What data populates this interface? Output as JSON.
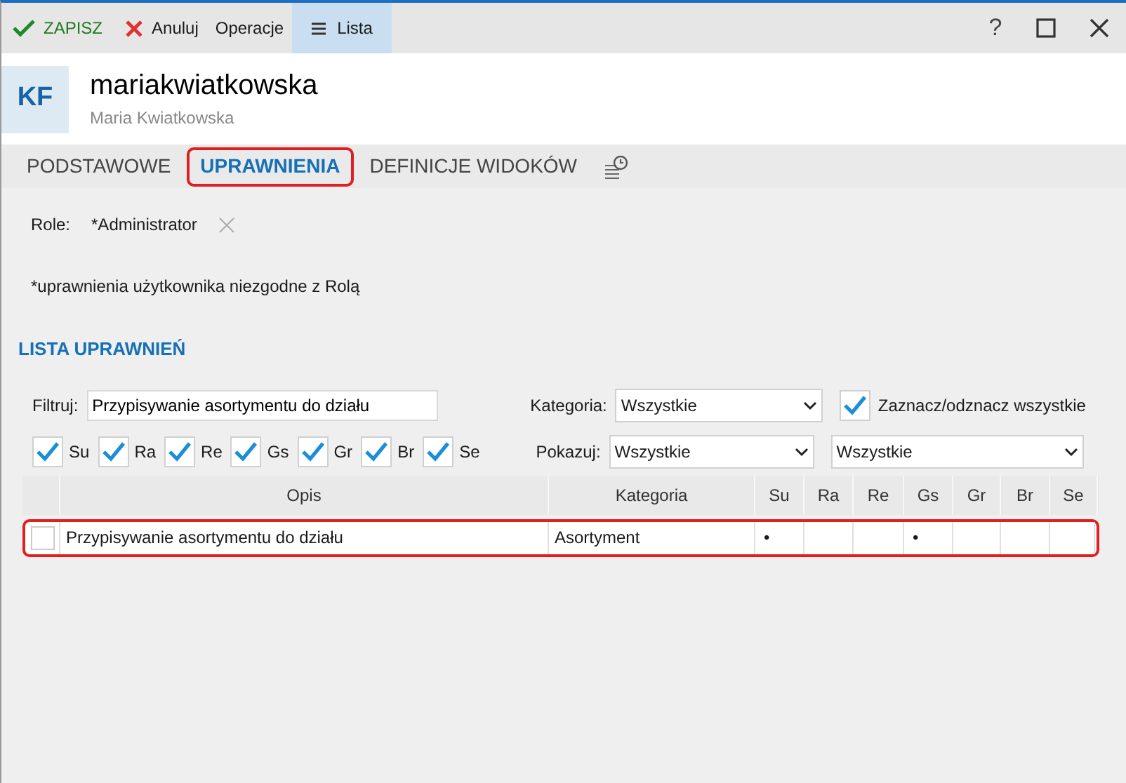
{
  "toolbar": {
    "save": "ZAPISZ",
    "cancel": "Anuluj",
    "operations": "Operacje",
    "list": {
      "label": "Lista",
      "selected": true
    },
    "help": "?"
  },
  "header": {
    "initials": "KF",
    "login": "mariakwiatkowska",
    "full_name": "Maria Kwiatkowska"
  },
  "tabs": [
    {
      "label": "PODSTAWOWE",
      "selected": false,
      "highlighted": false
    },
    {
      "label": "UPRAWNIENIA",
      "selected": true,
      "highlighted": true
    },
    {
      "label": "DEFINICJE WIDOKÓW",
      "selected": false,
      "highlighted": false
    }
  ],
  "roles": {
    "label": "Role:",
    "value": "*Administrator"
  },
  "note": "*uprawnienia użytkownika niezgodne z Rolą",
  "section_title": "LISTA UPRAWNIEŃ",
  "filter": {
    "label": "Filtruj:",
    "value": "Przypisywanie asortymentu do działu"
  },
  "category": {
    "label": "Kategoria:",
    "value": "Wszystkie"
  },
  "select_all": {
    "label": "Zaznacz/odznacz wszystkie",
    "checked": true
  },
  "column_toggles": [
    {
      "label": "Su",
      "checked": true
    },
    {
      "label": "Ra",
      "checked": true
    },
    {
      "label": "Re",
      "checked": true
    },
    {
      "label": "Gs",
      "checked": true
    },
    {
      "label": "Gr",
      "checked": true
    },
    {
      "label": "Br",
      "checked": true
    },
    {
      "label": "Se",
      "checked": true
    }
  ],
  "show": {
    "label": "Pokazuj:",
    "value": "Wszystkie",
    "value_2": "Wszystkie"
  },
  "table": {
    "columns": [
      "Opis",
      "Kategoria",
      "Su",
      "Ra",
      "Re",
      "Gs",
      "Gr",
      "Br",
      "Se"
    ],
    "rows": [
      {
        "checked": false,
        "highlighted": true,
        "cells": [
          "Przypisywanie asortymentu do działu",
          "Asortyment",
          "•",
          "",
          "",
          "•",
          "",
          "",
          ""
        ]
      }
    ]
  }
}
